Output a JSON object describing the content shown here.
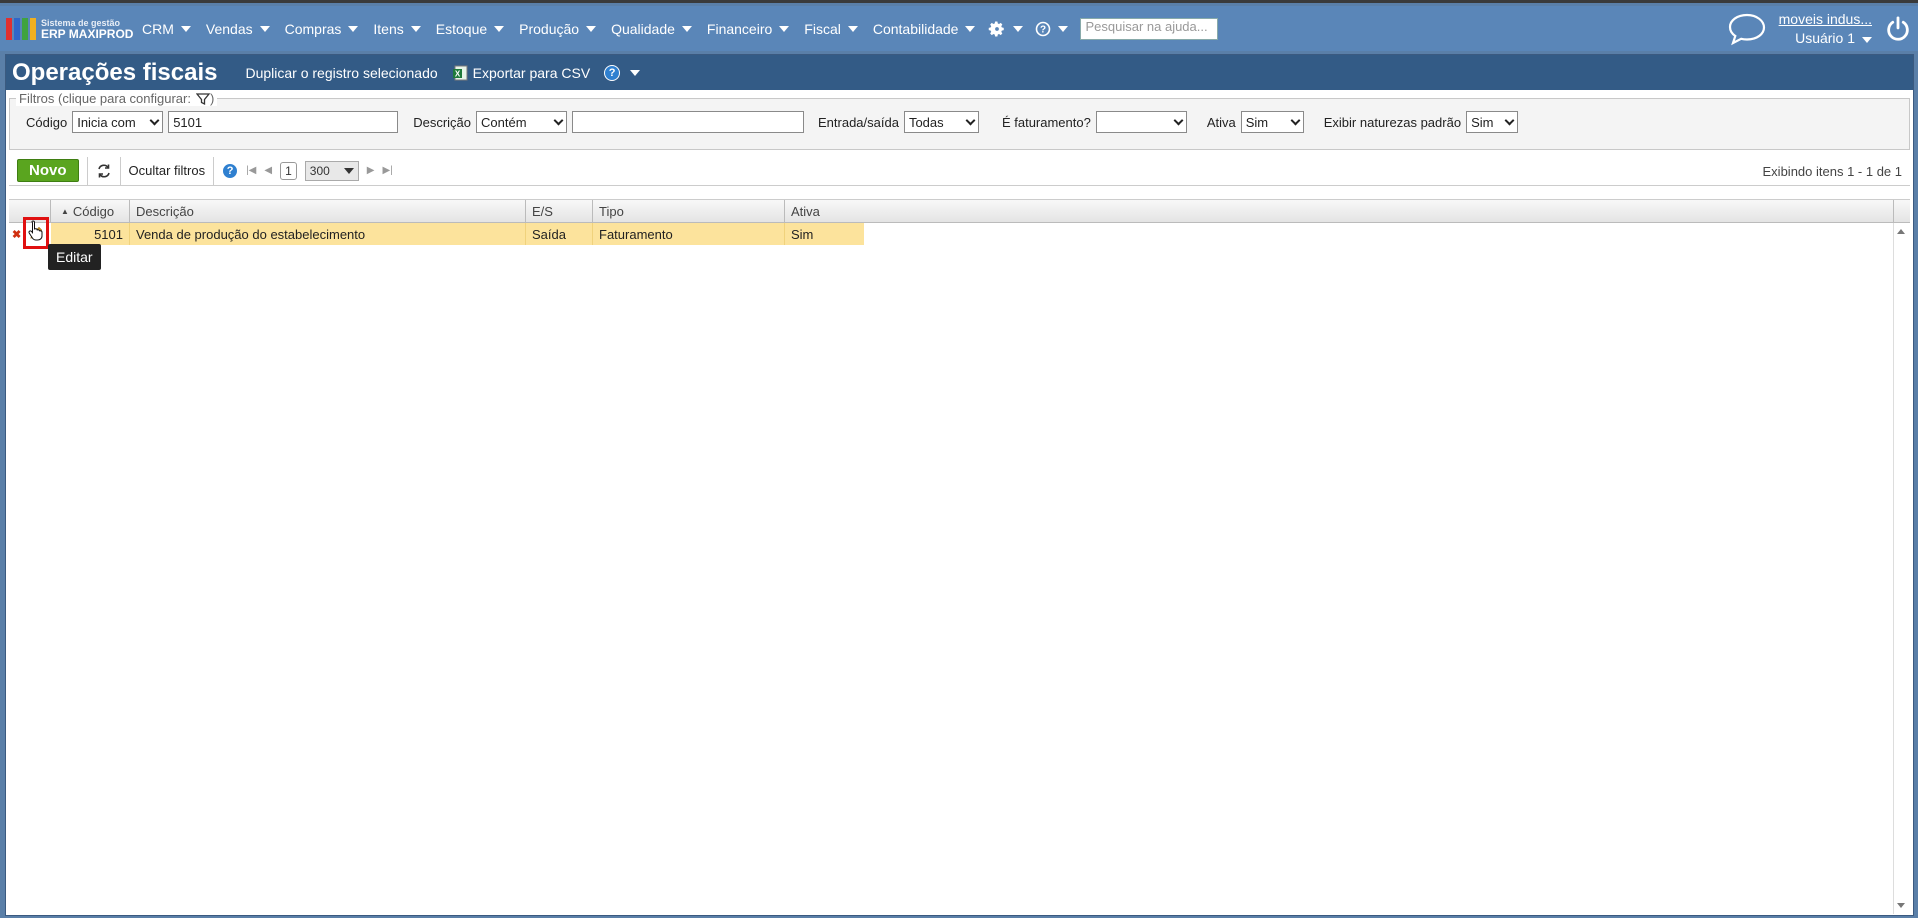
{
  "brand": {
    "line1": "Sistema de gestão",
    "line2": "ERP MAXIPROD",
    "colors": [
      "#e03030",
      "#2f66c9",
      "#3fa33f",
      "#f0b020"
    ]
  },
  "nav": {
    "items": [
      "CRM",
      "Vendas",
      "Compras",
      "Itens",
      "Estoque",
      "Produção",
      "Qualidade",
      "Financeiro",
      "Fiscal",
      "Contabilidade"
    ],
    "search_placeholder": "Pesquisar na ajuda...",
    "company": "moveis indus...",
    "user": "Usuário 1"
  },
  "page": {
    "title": "Operações fiscais",
    "duplicate_label": "Duplicar o registro selecionado",
    "export_label": "Exportar para CSV"
  },
  "filters": {
    "legend": "Filtros (clique para configurar:",
    "legend_close": ")",
    "codigo_label": "Código",
    "codigo_op": "Inicia com",
    "codigo_value": "5101",
    "descricao_label": "Descrição",
    "descricao_op": "Contém",
    "descricao_value": "",
    "es_label": "Entrada/saída",
    "es_value": "Todas",
    "fat_label": "É faturamento?",
    "fat_value": "",
    "ativa_label": "Ativa",
    "ativa_value": "Sim",
    "naturezas_label": "Exibir naturezas padrão",
    "naturezas_value": "Sim"
  },
  "toolbar": {
    "new_label": "Novo",
    "hide_filters_label": "Ocultar filtros",
    "page": "1",
    "page_size": "300",
    "showing": "Exibindo itens 1 - 1 de 1"
  },
  "grid": {
    "columns": [
      "Código",
      "Descrição",
      "E/S",
      "Tipo",
      "Ativa"
    ],
    "rows": [
      {
        "codigo": "5101",
        "descricao": "Venda de produção do estabelecimento",
        "es": "Saída",
        "tipo": "Faturamento",
        "ativa": "Sim"
      }
    ]
  },
  "tooltip": "Editar"
}
